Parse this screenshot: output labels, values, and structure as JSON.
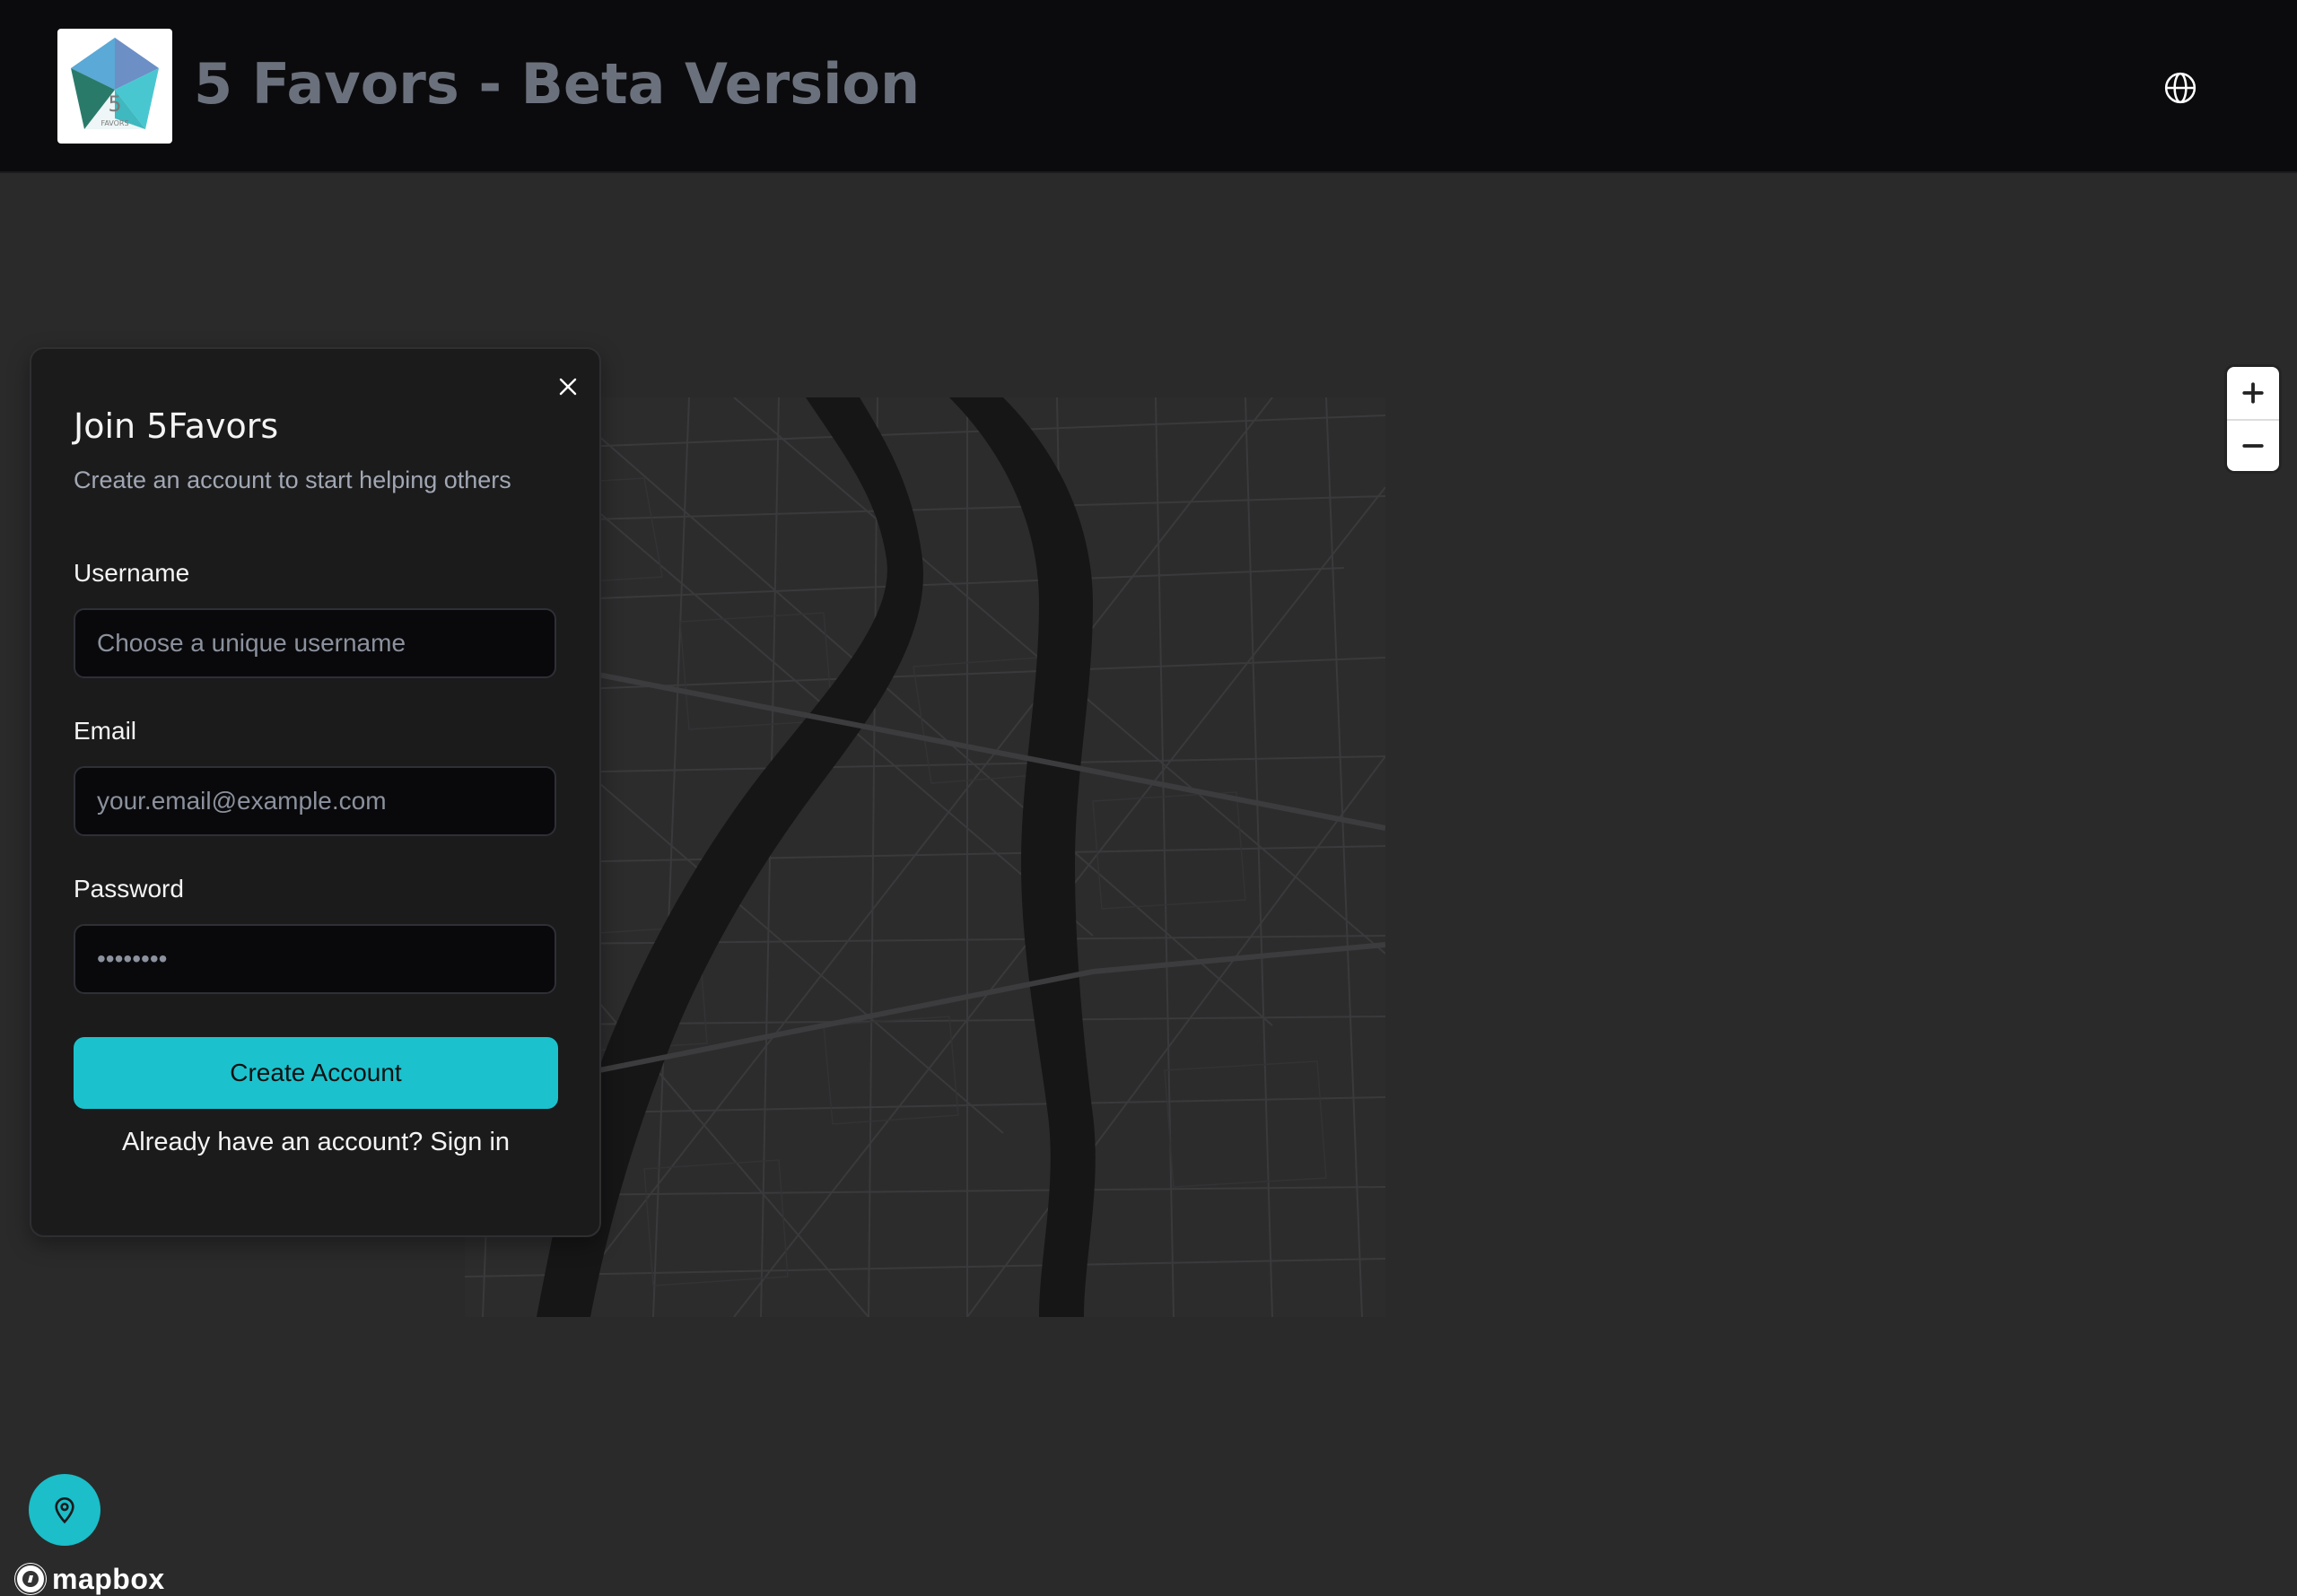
{
  "header": {
    "app_title": "5 Favors - Beta Version",
    "logo_text": "5",
    "logo_subtext": "FAVORS",
    "language_icon": "globe-icon"
  },
  "signup": {
    "title": "Join 5Favors",
    "subtitle": "Create an account to start helping others",
    "close_icon": "close-icon",
    "username": {
      "label": "Username",
      "placeholder": "Choose a unique username",
      "value": ""
    },
    "email": {
      "label": "Email",
      "placeholder": "your.email@example.com",
      "value": ""
    },
    "password": {
      "label": "Password",
      "placeholder": "••••••••",
      "value": ""
    },
    "submit_label": "Create Account",
    "signin_prompt": "Already have an account?",
    "signin_link": "Sign in"
  },
  "map": {
    "zoom_in_icon": "plus-icon",
    "zoom_out_icon": "minus-icon",
    "locate_icon": "map-pin-icon",
    "attribution_logo": "mapbox"
  },
  "colors": {
    "accent": "#1bc2cd",
    "header_bg": "#0b0b0d",
    "panel_bg": "#1b1b1c",
    "map_bg": "#2a2a2a",
    "title_text": "#6b717c"
  }
}
